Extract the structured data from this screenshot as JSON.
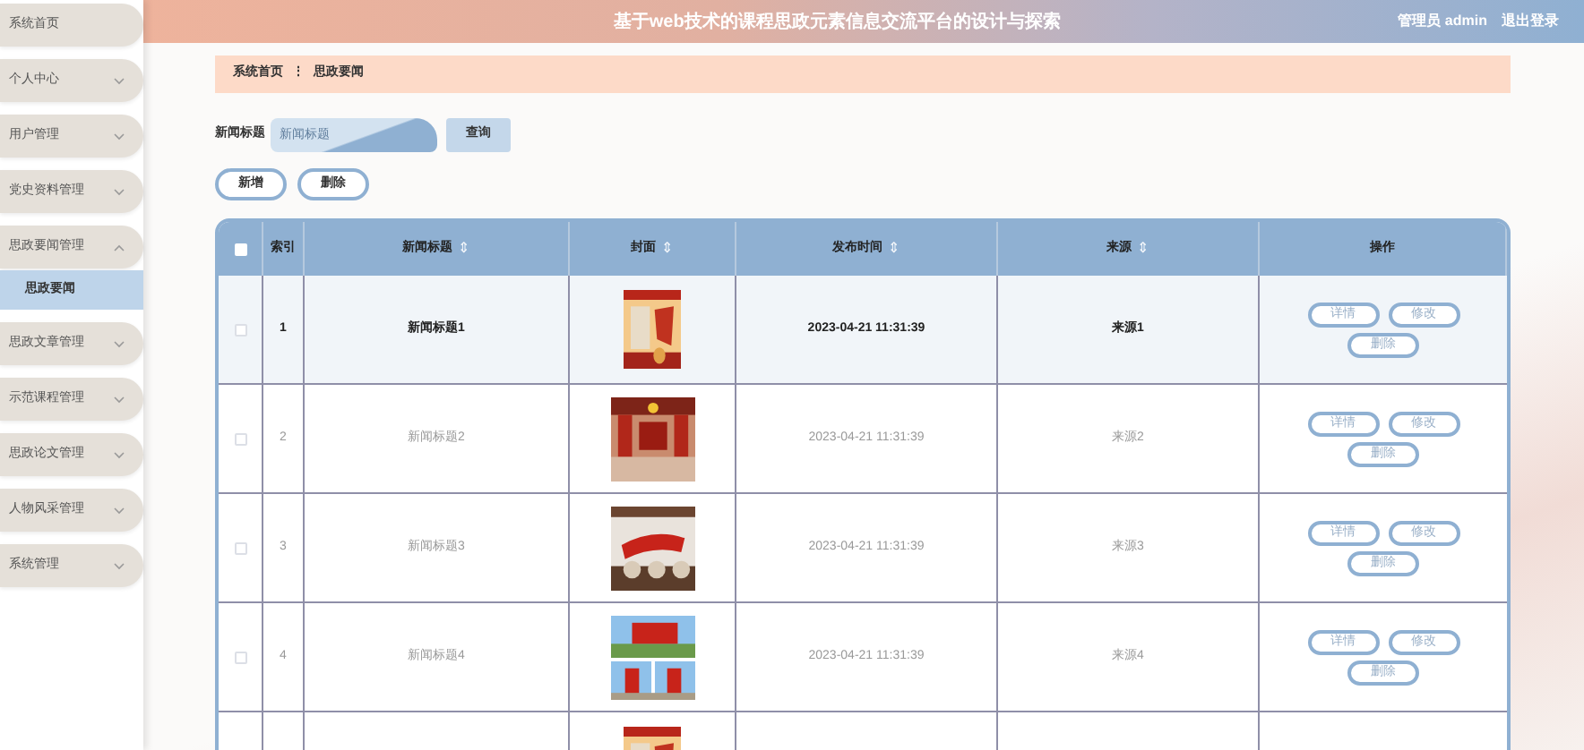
{
  "header": {
    "title": "基于web技术的课程思政元素信息交流平台的设计与探索",
    "user": "管理员 admin",
    "logout": "退出登录"
  },
  "sidebar": {
    "items": [
      {
        "label": "系统首页",
        "expandable": false
      },
      {
        "label": "个人中心",
        "expandable": true,
        "expanded": false
      },
      {
        "label": "用户管理",
        "expandable": true,
        "expanded": false
      },
      {
        "label": "党史资料管理",
        "expandable": true,
        "expanded": false
      },
      {
        "label": "思政要闻管理",
        "expandable": true,
        "expanded": true,
        "children": [
          {
            "label": "思政要闻",
            "selected": true
          }
        ]
      },
      {
        "label": "思政文章管理",
        "expandable": true,
        "expanded": false
      },
      {
        "label": "示范课程管理",
        "expandable": true,
        "expanded": false
      },
      {
        "label": "思政论文管理",
        "expandable": true,
        "expanded": false
      },
      {
        "label": "人物风采管理",
        "expandable": true,
        "expanded": false
      },
      {
        "label": "系统管理",
        "expandable": true,
        "expanded": false
      }
    ]
  },
  "breadcrumb": [
    "系统首页",
    "思政要闻"
  ],
  "breadcrumb_separator": "⋮",
  "search": {
    "label": "新闻标题",
    "placeholder": "新闻标题",
    "button": "查询"
  },
  "actions": [
    "新增",
    "删除"
  ],
  "table": {
    "columns": [
      {
        "label": "索引",
        "sortable": false
      },
      {
        "label": "新闻标题",
        "sortable": true
      },
      {
        "label": "封面",
        "sortable": true
      },
      {
        "label": "发布时间",
        "sortable": true
      },
      {
        "label": "来源",
        "sortable": true
      },
      {
        "label": "操作",
        "sortable": false
      }
    ],
    "sort_icon": "⇕",
    "all_checked": false,
    "rows": [
      {
        "index": "1",
        "title": "新闻标题1",
        "time": "2023-04-21 11:31:39",
        "source": "来源1",
        "highlighted": true,
        "checked": false,
        "buttons": [
          "详情",
          "修改",
          "删除"
        ]
      },
      {
        "index": "2",
        "title": "新闻标题2",
        "time": "2023-04-21 11:31:39",
        "source": "来源2",
        "highlighted": false,
        "checked": false,
        "buttons": [
          "详情",
          "修改",
          "删除"
        ]
      },
      {
        "index": "3",
        "title": "新闻标题3",
        "time": "2023-04-21 11:31:39",
        "source": "来源3",
        "highlighted": false,
        "checked": false,
        "buttons": [
          "详情",
          "修改",
          "删除"
        ]
      },
      {
        "index": "4",
        "title": "新闻标题4",
        "time": "2023-04-21 11:31:39",
        "source": "来源4",
        "highlighted": false,
        "checked": false,
        "buttons": [
          "详情",
          "修改",
          "删除"
        ]
      },
      {
        "highlighted": false
      }
    ]
  }
}
